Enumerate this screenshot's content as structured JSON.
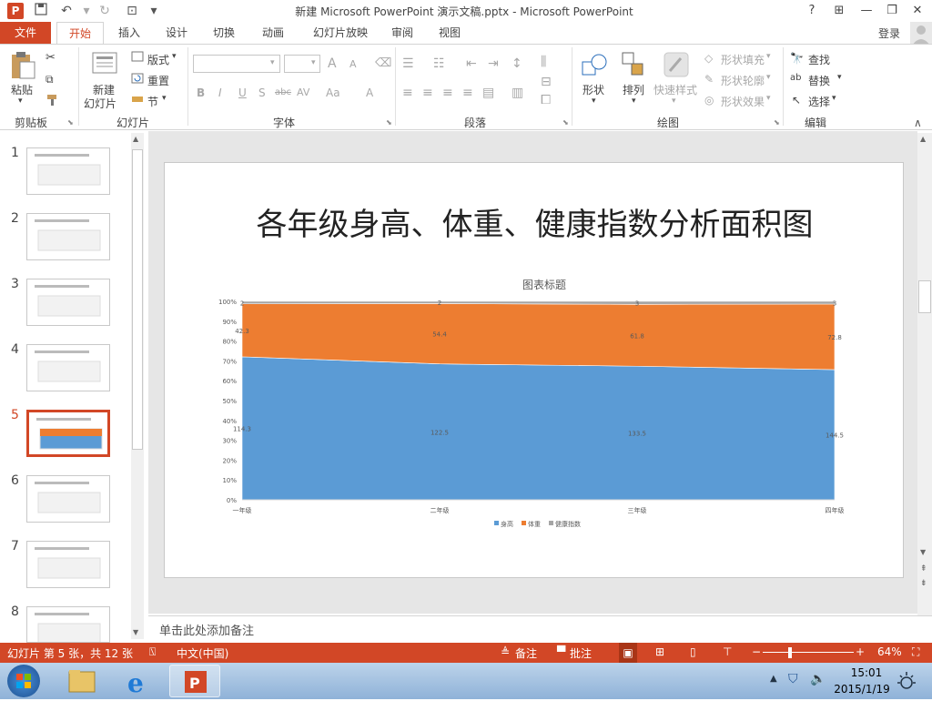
{
  "window": {
    "title": "新建 Microsoft PowerPoint 演示文稿.pptx - Microsoft PowerPoint",
    "help": "?",
    "controls": [
      "restore-ribbon",
      "minimize",
      "maximize",
      "close"
    ]
  },
  "tabs": {
    "file": "文件",
    "home": "开始",
    "insert": "插入",
    "design": "设计",
    "transitions": "切换",
    "animations": "动画",
    "slideshow": "幻灯片放映",
    "review": "审阅",
    "view": "视图",
    "login": "登录"
  },
  "ribbon": {
    "clipboard": {
      "paste": "粘贴",
      "label": "剪贴板"
    },
    "slides": {
      "new_slide": "新建\n幻灯片",
      "new_slide_l1": "新建",
      "new_slide_l2": "幻灯片",
      "layout": "版式",
      "reset": "重置",
      "section": "节",
      "label": "幻灯片"
    },
    "font": {
      "grow": "A",
      "shrink": "A",
      "bold": "B",
      "italic": "I",
      "underline": "U",
      "shadow": "S",
      "strike": "abc",
      "spacing": "AV",
      "case": "Aa",
      "color": "A",
      "label": "字体"
    },
    "paragraph": {
      "label": "段落"
    },
    "drawing": {
      "shapes": "形状",
      "arrange": "排列",
      "quick_styles": "快速样式",
      "fill": "形状填充",
      "outline": "形状轮廓",
      "effects": "形状效果",
      "label": "绘图"
    },
    "editing": {
      "find": "查找",
      "replace": "替换",
      "select": "选择",
      "label": "编辑"
    }
  },
  "thumbnails": {
    "numbers": [
      "1",
      "2",
      "3",
      "4",
      "5",
      "6",
      "7",
      "8"
    ],
    "selected": "5"
  },
  "slide": {
    "title": "各年级身高、体重、健康指数分析面积图"
  },
  "chart_data": {
    "type": "area",
    "stacking": "percent",
    "title": "图表标题",
    "categories": [
      "一年级",
      "二年级",
      "三年级",
      "四年级"
    ],
    "y_ticks": [
      "0%",
      "10%",
      "20%",
      "30%",
      "40%",
      "50%",
      "60%",
      "70%",
      "80%",
      "90%",
      "100%"
    ],
    "ylim": [
      0,
      100
    ],
    "series": [
      {
        "name": "身高",
        "values": [
          114.3,
          122.5,
          133.5,
          144.5
        ],
        "labels": [
          "114.3",
          "122.5",
          "133.5",
          "144.5"
        ],
        "color": "#5b9bd5"
      },
      {
        "name": "体重",
        "values": [
          42.3,
          54.4,
          61.8,
          72.8
        ],
        "labels": [
          "42.3",
          "54.4",
          "61.8",
          "72.8"
        ],
        "color": "#ed7d31"
      },
      {
        "name": "健康指数",
        "values": [
          2,
          2,
          3,
          3
        ],
        "labels": [
          "2",
          "2",
          "3",
          "3"
        ],
        "color": "#a5a5a5"
      }
    ],
    "legend_position": "bottom",
    "grid": false
  },
  "notes": {
    "placeholder": "单击此处添加备注"
  },
  "status": {
    "slide_info": "幻灯片 第 5 张，共 12 张",
    "language": "中文(中国)",
    "notes": "备注",
    "comments": "批注",
    "zoom": "64%"
  },
  "taskbar": {
    "time": "15:01",
    "date": "2015/1/19"
  },
  "colors": {
    "accent": "#d24726",
    "blue": "#5b9bd5",
    "orange": "#ed7d31",
    "gray": "#a5a5a5"
  }
}
